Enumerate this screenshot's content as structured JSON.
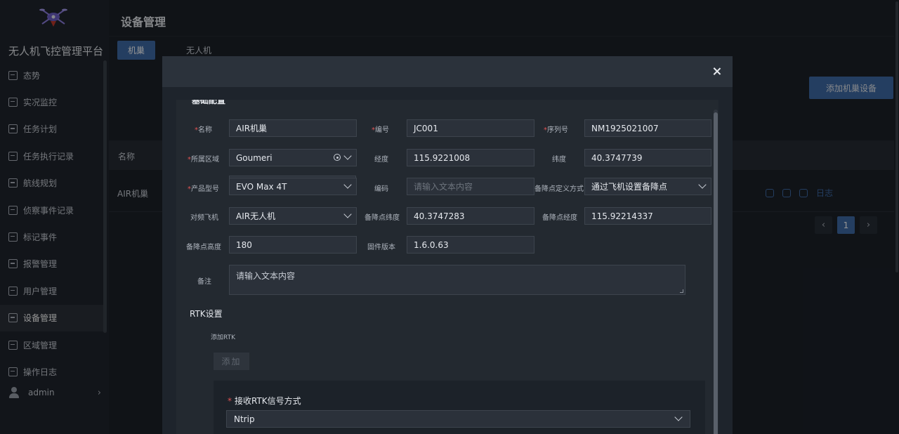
{
  "app": {
    "title": "无人机飞控管理平台"
  },
  "sidebar": {
    "items": [
      {
        "label": "态势",
        "icon": "chart-icon"
      },
      {
        "label": "实况监控",
        "icon": "monitor-icon"
      },
      {
        "label": "任务计划",
        "icon": "calendar-icon"
      },
      {
        "label": "任务执行记录",
        "icon": "list-icon"
      },
      {
        "label": "航线规划",
        "icon": "route-icon"
      },
      {
        "label": "侦察事件记录",
        "icon": "record-icon"
      },
      {
        "label": "标记事件",
        "icon": "mark-icon"
      },
      {
        "label": "报警管理",
        "icon": "alarm-icon"
      },
      {
        "label": "用户管理",
        "icon": "user-icon"
      },
      {
        "label": "设备管理",
        "icon": "device-icon",
        "active": true
      },
      {
        "label": "区域管理",
        "icon": "area-icon"
      },
      {
        "label": "操作日志",
        "icon": "log-icon"
      }
    ],
    "user": "admin"
  },
  "header": {
    "page_title": "设备管理"
  },
  "tabs": [
    {
      "label": "机巢"
    },
    {
      "label": "无人机"
    }
  ],
  "toolbar": {
    "add_label": "添加机巢设备"
  },
  "table": {
    "column_name": "名称",
    "rows": [
      {
        "name": "AIR机巢",
        "log_label": "日志"
      }
    ]
  },
  "pagination": {
    "current": "1"
  },
  "modal": {
    "section_title": "基础配置",
    "fields": {
      "name": {
        "label": "名称",
        "value": "AIR机巢"
      },
      "code": {
        "label": "编号",
        "value": "JC001"
      },
      "serial": {
        "label": "序列号",
        "value": "NM1925021007"
      },
      "region": {
        "label": "所属区域",
        "value": "Goumeri"
      },
      "longitude": {
        "label": "经度",
        "value": "115.9221008"
      },
      "latitude": {
        "label": "纬度",
        "value": "40.3747739"
      },
      "product_model": {
        "label": "产品型号",
        "value": "EVO Max 4T"
      },
      "encoding": {
        "label": "编码",
        "placeholder": "请输入文本内容"
      },
      "backup_method": {
        "label": "备降点定义方式",
        "value": "通过飞机设置备降点"
      },
      "paired_drone": {
        "label": "对频飞机",
        "value": "AIR无人机"
      },
      "backup_lat": {
        "label": "备降点纬度",
        "value": "40.3747283"
      },
      "backup_lng": {
        "label": "备降点经度",
        "value": "115.92214337"
      },
      "backup_alt": {
        "label": "备降点高度",
        "value": "180"
      },
      "firmware": {
        "label": "固件版本",
        "value": "1.6.0.63"
      },
      "remark": {
        "label": "备注",
        "placeholder": "请输入文本内容"
      }
    },
    "rtk": {
      "title": "RTK设置",
      "add_label": "添加RTK",
      "add_button": "添加",
      "signal_label": "接收RTK信号方式",
      "signal_value": "Ntrip"
    }
  }
}
